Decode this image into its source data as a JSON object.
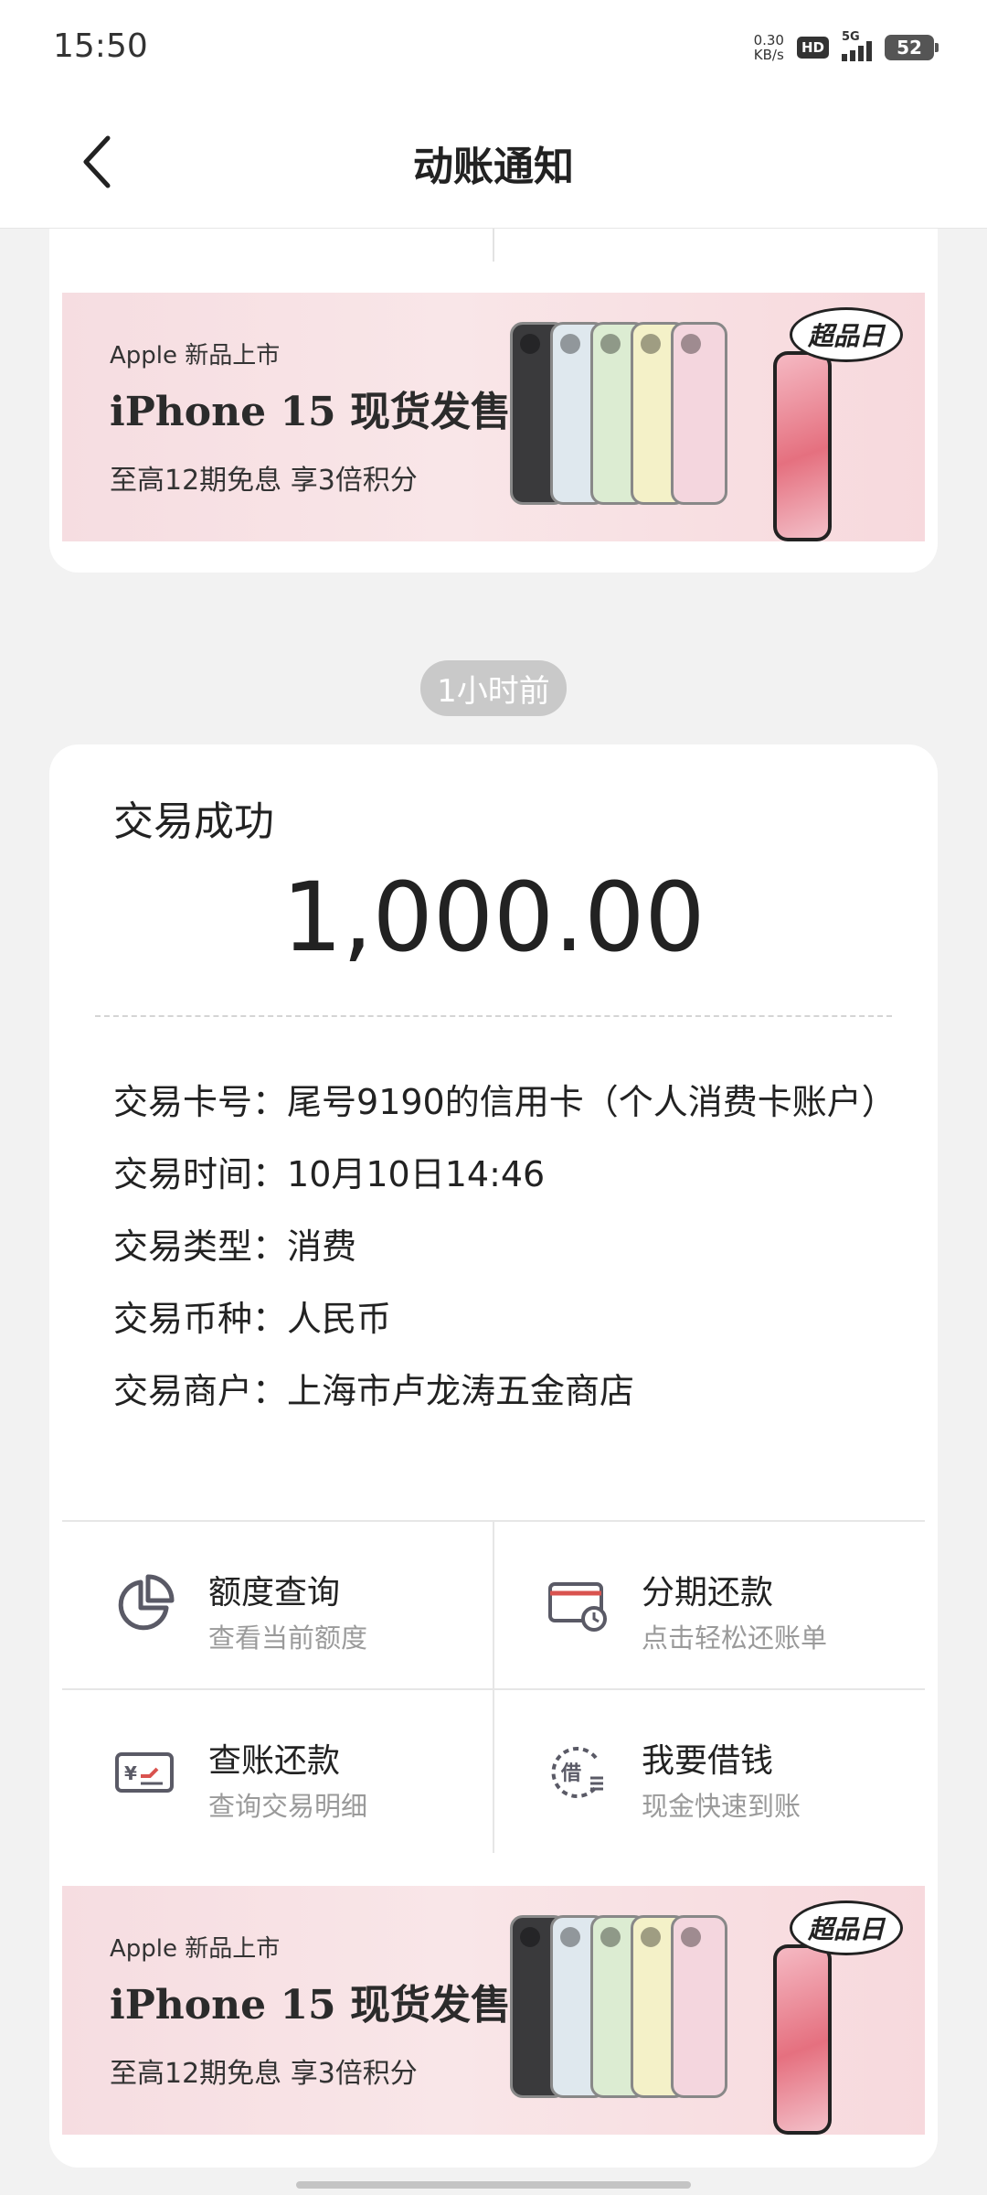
{
  "status_bar": {
    "time": "15:50",
    "net_speed_value": "0.30",
    "net_speed_unit": "KB/s",
    "hd_label": "HD",
    "network_label": "5G",
    "battery_level": "52"
  },
  "header": {
    "title": "动账通知",
    "back_icon": "chevron-left-icon"
  },
  "promo_banner": {
    "subtitle": "Apple 新品上市",
    "title": "iPhone 15 现货发售",
    "desc": "至高12期免息 享3倍积分",
    "logo_text": "超品日"
  },
  "time_chip": "1小时前",
  "transaction": {
    "status": "交易成功",
    "amount": "1,000.00",
    "details": [
      {
        "label": "交易卡号：",
        "value": "尾号9190的信用卡（个人消费卡账户）"
      },
      {
        "label": "交易时间：",
        "value": "10月10日14:46"
      },
      {
        "label": "交易类型：",
        "value": "消费"
      },
      {
        "label": "交易币种：",
        "value": "人民币"
      },
      {
        "label": "交易商户：",
        "value": "上海市卢龙涛五金商店"
      }
    ]
  },
  "actions": [
    {
      "title": "额度查询",
      "sub": "查看当前额度",
      "icon": "pie-chart-icon"
    },
    {
      "title": "分期还款",
      "sub": "点击轻松还账单",
      "icon": "card-clock-icon"
    },
    {
      "title": "查账还款",
      "sub": "查询交易明细",
      "icon": "yuan-card-icon"
    },
    {
      "title": "我要借钱",
      "sub": "现金快速到账",
      "icon": "borrow-icon"
    }
  ],
  "colors": {
    "accent_red": "#d9534f",
    "icon_gray": "#5a5a66",
    "banner_pink": "#f6dde1"
  }
}
